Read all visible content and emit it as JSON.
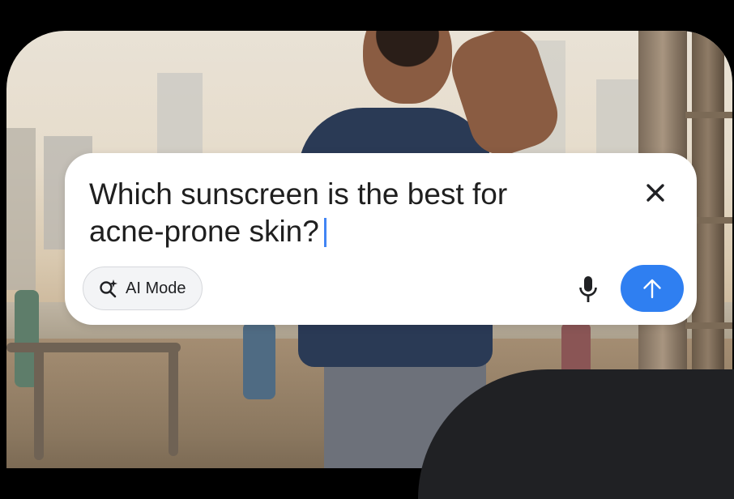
{
  "search": {
    "query_line1": "Which sunscreen is the best for",
    "query_line2": "acne-prone skin?",
    "close_icon": "close-icon",
    "ai_mode_label": "AI Mode",
    "ai_mode_icon": "search-sparkle-icon",
    "mic_icon": "microphone-icon",
    "send_icon": "arrow-up-icon"
  },
  "colors": {
    "accent": "#2f7ff1",
    "caret": "#4285f4",
    "card_background": "#ffffff",
    "chip_background": "#f3f4f6",
    "dark_corner": "#202124"
  }
}
